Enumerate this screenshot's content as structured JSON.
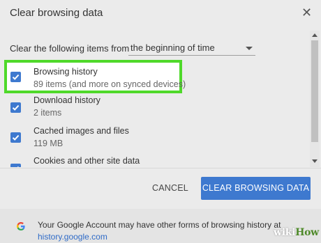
{
  "dialog": {
    "title": "Clear browsing data",
    "close_icon": "close-icon"
  },
  "time_range": {
    "label": "Clear the following items from",
    "selected": "the beginning of time"
  },
  "items": [
    {
      "label": "Browsing history",
      "detail": "89 items (and more on synced devices)",
      "checked": true
    },
    {
      "label": "Download history",
      "detail": "2 items",
      "checked": true
    },
    {
      "label": "Cached images and files",
      "detail": "119 MB",
      "checked": true
    },
    {
      "label": "Cookies and other site data",
      "detail": "",
      "checked": true
    }
  ],
  "buttons": {
    "cancel": "CANCEL",
    "clear": "CLEAR BROWSING DATA"
  },
  "footer": {
    "text": "Your Google Account may have other forms of browsing history at",
    "link": "history.google.com"
  },
  "watermark": {
    "part1": "wiki",
    "part2": "How"
  },
  "colors": {
    "accent": "#3e79cf",
    "highlight": "#4fd92a",
    "link": "#2f6bc7"
  }
}
